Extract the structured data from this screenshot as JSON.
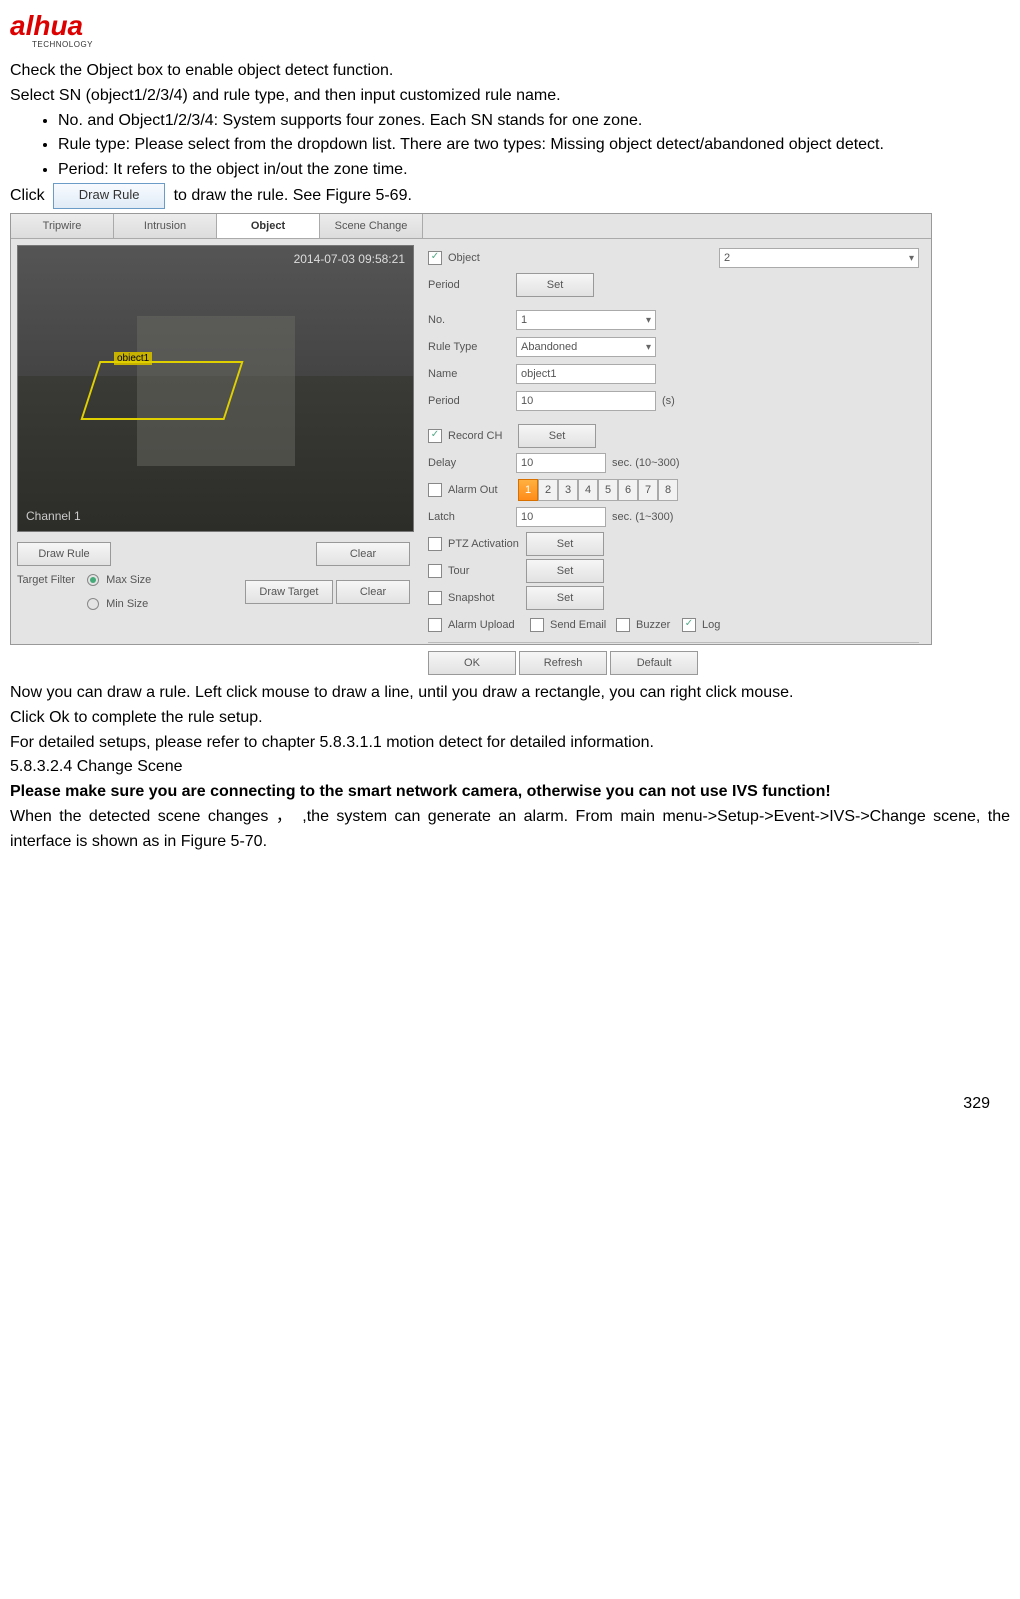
{
  "logo": {
    "text": "alhua",
    "sub": "TECHNOLOGY"
  },
  "intro": {
    "l1": "Check the Object box to enable object detect function.",
    "l2": "Select SN (object1/2/3/4) and rule type, and then input customized rule name.",
    "b1": "No. and Object1/2/3/4: System supports four zones. Each SN stands for one zone.",
    "b2": "Rule type: Please select from the dropdown list. There are two types: Missing object detect/abandoned object detect.",
    "b3": "Period: It refers to the object in/out the zone time."
  },
  "click": {
    "pre": "Click ",
    "btn": "Draw Rule",
    "post": " to draw the rule. See Figure 5-69."
  },
  "fig": {
    "tabs": {
      "t1": "Tripwire",
      "t2": "Intrusion",
      "t3": "Object",
      "t4": "Scene Change"
    },
    "cam": {
      "ts": "2014-07-03 09:58:21",
      "ch": "Channel 1",
      "label": "object1"
    },
    "left": {
      "draw_rule": "Draw Rule",
      "clear": "Clear",
      "target_filter": "Target Filter",
      "max": "Max Size",
      "min": "Min Size",
      "draw_target": "Draw Target"
    },
    "form": {
      "object": "Object",
      "object_val": "2",
      "period": "Period",
      "set": "Set",
      "no": "No.",
      "no_val": "1",
      "rule_type": "Rule Type",
      "rule_type_val": "Abandoned",
      "name": "Name",
      "name_val": "object1",
      "period2": "Period",
      "period2_val": "10",
      "period2_unit": "(s)",
      "record_ch": "Record CH",
      "delay": "Delay",
      "delay_val": "10",
      "delay_unit": "sec. (10~300)",
      "alarm_out": "Alarm Out",
      "latch": "Latch",
      "latch_val": "10",
      "latch_unit": "sec. (1~300)",
      "ptz": "PTZ Activation",
      "tour": "Tour",
      "snapshot": "Snapshot",
      "alarm_upload": "Alarm Upload",
      "send_email": "Send Email",
      "buzzer": "Buzzer",
      "log": "Log",
      "n1": "1",
      "n2": "2",
      "n3": "3",
      "n4": "4",
      "n5": "5",
      "n6": "6",
      "n7": "7",
      "n8": "8",
      "ok": "OK",
      "refresh": "Refresh",
      "default": "Default"
    },
    "caption": "Figure 5-69"
  },
  "after": {
    "p1": "Now you can draw a rule. Left click mouse to draw a line, until you draw a rectangle, you can right click mouse.",
    "p2": "Click Ok to complete the rule setup.",
    "p3": "For detailed setups, please refer to chapter 5.8.3.1.1 motion detect for detailed information.",
    "section": "5.8.3.2.4 Change Scene",
    "warn": "Please make sure you are connecting to the smart network camera, otherwise you can not use IVS function!",
    "p4": "When the detected scene changes ， ,the system can generate an alarm. From main menu->Setup->Event->IVS->Change scene, the interface is shown as in Figure 5-70."
  },
  "page_num": "329"
}
